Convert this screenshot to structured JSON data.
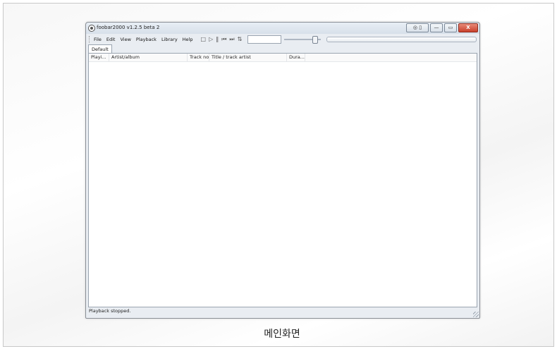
{
  "window": {
    "title": "foobar2000 v1.2.5 beta 2",
    "caption_buttons": {
      "extra": "◎ ▯",
      "minimize": "—",
      "maximize": "▭",
      "close": "X"
    }
  },
  "menu": [
    "File",
    "Edit",
    "View",
    "Playback",
    "Library",
    "Help"
  ],
  "transport": [
    "□",
    "▷",
    "‖",
    "⏮",
    "⏭",
    "⇅"
  ],
  "tabs": [
    "Default"
  ],
  "columns": [
    "Playi...",
    "Artist/album",
    "Track no",
    "Title / track artist",
    "Dura..."
  ],
  "status": "Playback stopped.",
  "caption": "메인화면"
}
